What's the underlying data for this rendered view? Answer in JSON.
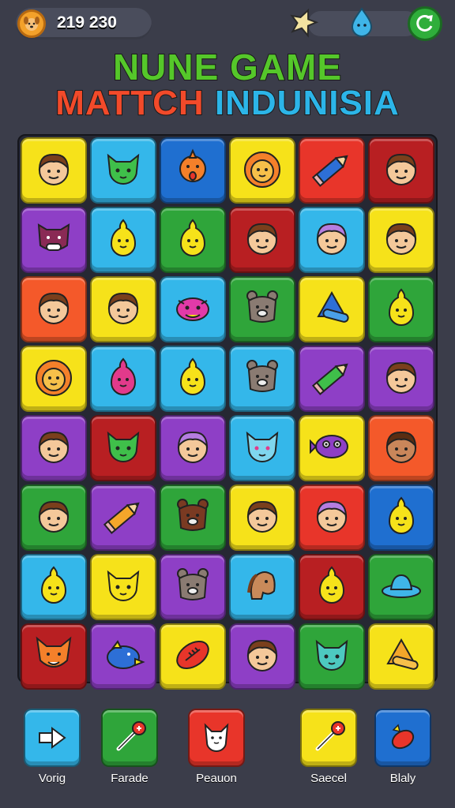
{
  "header": {
    "coin_count": "219 230",
    "title_line1": "NUNE GAME",
    "title_line2_part1": "MATTCH",
    "title_line2_part2": "INDUNISIA"
  },
  "colors": {
    "yellow": "#f6e21a",
    "cyan": "#34b7ea",
    "blue": "#1f6fd0",
    "red": "#e8352a",
    "darkred": "#b81f22",
    "orange": "#f4592a",
    "purple": "#8e3fc6",
    "green": "#2fa53a"
  },
  "board": {
    "rows": [
      [
        [
          "yellow",
          "face"
        ],
        [
          "cyan",
          "cat-green"
        ],
        [
          "blue",
          "orange-critter"
        ],
        [
          "yellow",
          "lion"
        ],
        [
          "red",
          "pencil-blue"
        ],
        [
          "darkred",
          "face"
        ]
      ],
      [
        [
          "purple",
          "boar"
        ],
        [
          "cyan",
          "chick"
        ],
        [
          "green",
          "chick"
        ],
        [
          "darkred",
          "face"
        ],
        [
          "cyan",
          "face-purple"
        ],
        [
          "yellow",
          "face"
        ]
      ],
      [
        [
          "orange",
          "face"
        ],
        [
          "yellow",
          "face"
        ],
        [
          "cyan",
          "pink-critter"
        ],
        [
          "green",
          "bear-gray"
        ],
        [
          "yellow",
          "tent-blue"
        ],
        [
          "green",
          "chick"
        ]
      ],
      [
        [
          "yellow",
          "lion"
        ],
        [
          "cyan",
          "pink-chick"
        ],
        [
          "cyan",
          "chick"
        ],
        [
          "cyan",
          "bear-gray"
        ],
        [
          "purple",
          "pencil-green"
        ],
        [
          "purple",
          "face"
        ]
      ],
      [
        [
          "purple",
          "face"
        ],
        [
          "darkred",
          "cat-green"
        ],
        [
          "purple",
          "face-purple"
        ],
        [
          "cyan",
          "cat-cyan"
        ],
        [
          "yellow",
          "purple-fish"
        ],
        [
          "orange",
          "face-dark"
        ]
      ],
      [
        [
          "green",
          "face"
        ],
        [
          "purple",
          "pencil-orange"
        ],
        [
          "green",
          "bear-brown"
        ],
        [
          "yellow",
          "face"
        ],
        [
          "red",
          "face-purple"
        ],
        [
          "blue",
          "chick"
        ]
      ],
      [
        [
          "cyan",
          "chick"
        ],
        [
          "yellow",
          "cat-yellow"
        ],
        [
          "purple",
          "bear-gray"
        ],
        [
          "cyan",
          "horse"
        ],
        [
          "darkred",
          "chick"
        ],
        [
          "green",
          "hat-blue"
        ]
      ],
      [
        [
          "darkred",
          "fox"
        ],
        [
          "purple",
          "bird-blue"
        ],
        [
          "yellow",
          "football"
        ],
        [
          "purple",
          "face"
        ],
        [
          "green",
          "cat-teal"
        ],
        [
          "yellow",
          "tent-orange"
        ]
      ]
    ]
  },
  "footer": {
    "buttons": [
      {
        "label": "Vorig",
        "color": "#34b7ea",
        "icon": "play-icon"
      },
      {
        "label": "Farade",
        "color": "#2fa53a",
        "icon": "wand-icon"
      },
      {
        "label": "Peauon",
        "color": "#e8352a",
        "icon": "cat-icon"
      },
      {
        "label": "Saecel",
        "color": "#f6e21a",
        "icon": "wand-icon"
      },
      {
        "label": "Blaly",
        "color": "#1f6fd0",
        "icon": "bird-icon"
      }
    ]
  }
}
